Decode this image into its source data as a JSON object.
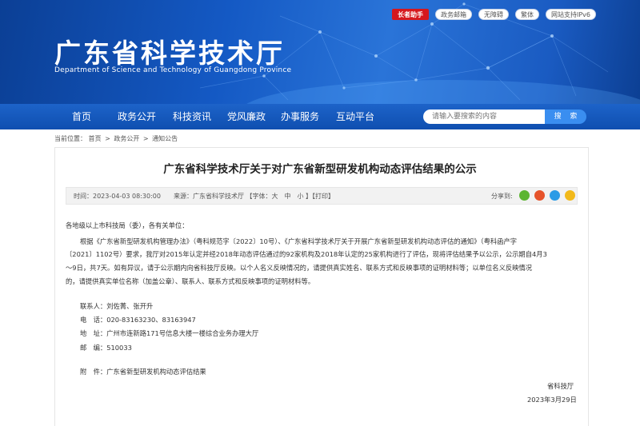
{
  "header": {
    "site_title": "广东省科学技术厅",
    "site_subtitle": "Department of Science and Technology of Guangdong Province",
    "top_links": {
      "elder": "长者助手",
      "gov_mail": "政务邮箱",
      "accessibility": "无障碍",
      "traditional": "繁体",
      "ipv6": "网站支持IPv6"
    }
  },
  "nav": {
    "items": [
      "首页",
      "政务公开",
      "科技资讯",
      "党风廉政",
      "办事服务",
      "互动平台"
    ],
    "search_placeholder": "请输入要搜索的内容",
    "search_button": "搜 索"
  },
  "breadcrumb": {
    "prefix": "当前位置：",
    "items": [
      "首页",
      "政务公开",
      "通知公告"
    ],
    "sep": ">"
  },
  "article": {
    "title": "广东省科学技术厅关于对广东省新型研发机构动态评估结果的公示",
    "meta": "时间：2023-04-03 08:30:00　　来源：广东省科学技术厅 【字体：大　中　小 】【打印】",
    "share_label": "分享到:",
    "greeting": "各地级以上市科技局（委），各有关单位：",
    "para_lines": [
      "根据《广东省新型研发机构管理办法》（粤科规范字〔2022〕10号）、《广东省科学技术厅关于开展广东省新型研发机构动态评估的通知》（粤科函产字",
      "〔2021〕1102号）要求，我厅对2015年认定并经2018年动态评估通过的92家机构及2018年认定的25家机构进行了评估，现将评估结果予以公示，公示期自4月3",
      "～9日，共7天。如有异议，请于公示期内向省科技厅反映。以个人名义反映情况的，请提供真实姓名、联系方式和反映事项的证明材料等；以单位名义反映情况",
      "的，请提供真实单位名称（加盖公章）、联系人、联系方式和反映事项的证明材料等。"
    ],
    "contact_label": "联系人：",
    "contact": "刘佐菁、张开升",
    "phone_label": "电　话：",
    "phone": "020-83163230、83163947",
    "address_label": "地　址：",
    "address": "广州市连新路171号信息大楼一楼综合业务办理大厅",
    "postcode_label": "邮　编：",
    "postcode": "510033",
    "attachment_label": "附　件：",
    "attachment": "广东省新型研发机构动态评估结果",
    "signature": "省科技厅",
    "date": "2023年3月29日"
  },
  "colors": {
    "banner": "#1459c4",
    "nav": "#1459c4",
    "search_button": "#3a8ef0",
    "elder_badge": "#d6171d",
    "share_wechat": "#5cb531",
    "share_weibo": "#e6532b",
    "share_qq": "#2a9be6",
    "share_qzone": "#f2b91a"
  }
}
